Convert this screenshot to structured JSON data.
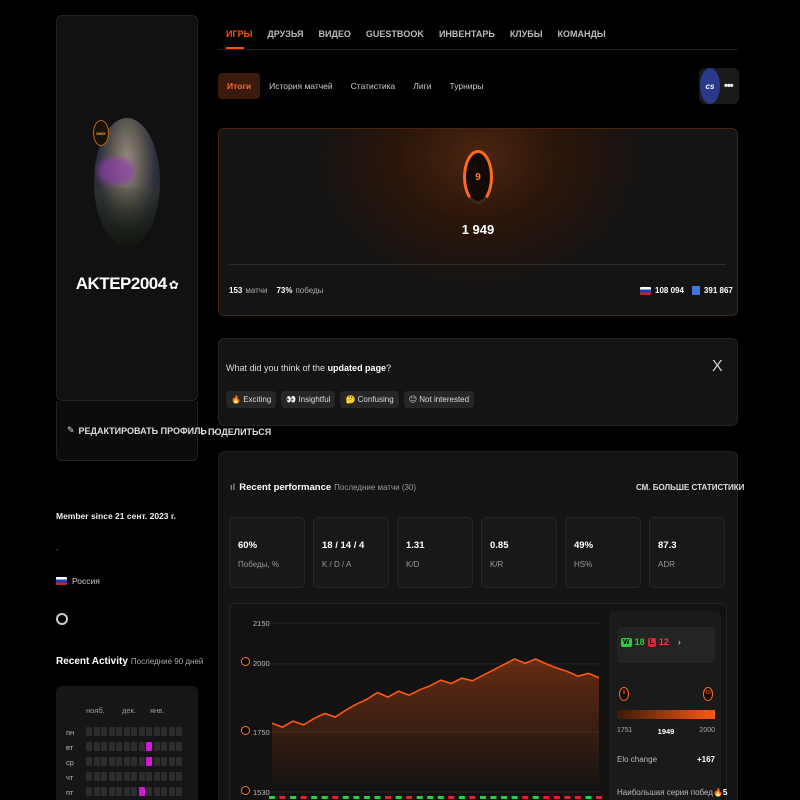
{
  "profile": {
    "username": "AKTEP2004",
    "level_badge": "MMX",
    "edit_label": "РЕДАКТИРОВАТЬ ПРОФИЛЬ",
    "share_label": "ПОДЕЛИТЬСЯ",
    "member_since": "Member since 21 сент. 2023 г.",
    "dot": ".",
    "country": "Россия"
  },
  "activity": {
    "title": "Recent Activity",
    "subtitle": "Последние 90 дней",
    "months": [
      "нояб.",
      "дек.",
      "янв."
    ],
    "days": [
      "пн",
      "вт",
      "ср",
      "чт",
      "пт"
    ]
  },
  "nav": {
    "items": [
      "ИГРЫ",
      "ДРУЗЬЯ",
      "ВИДЕО",
      "GUESTBOOK",
      "ИНВЕНТАРЬ",
      "КЛУБЫ",
      "КОМАНДЫ"
    ]
  },
  "subtabs": [
    "Итоги",
    "История матчей",
    "Статистика",
    "Лиги",
    "Турниры"
  ],
  "game_logo": "cs",
  "elo": {
    "level": "9",
    "value": "1 949",
    "matches": "153",
    "matches_label": "матчи",
    "winrate": "73%",
    "winrate_label": "победы",
    "country_rank": "108 094",
    "world_rank": "391 867"
  },
  "feedback": {
    "question_start": "What did you think of the ",
    "question_bold": "updated page",
    "question_end": "?",
    "close": "X",
    "options": [
      {
        "emoji": "🔥",
        "label": "Exciting"
      },
      {
        "emoji": "👀",
        "label": "Insightful"
      },
      {
        "emoji": "🤔",
        "label": "Confusing"
      },
      {
        "emoji": "😐",
        "label": "Not interested"
      }
    ]
  },
  "performance": {
    "title": "Recent performance",
    "subtitle": "Последние матчи (30)",
    "more": "СМ. БОЛЬШЕ СТАТИСТИКИ",
    "stats": [
      {
        "value": "60%",
        "label": "Победы, %"
      },
      {
        "value": "18 / 14 / 4",
        "label": "K / D / A"
      },
      {
        "value": "1.31",
        "label": "K/D"
      },
      {
        "value": "0.85",
        "label": "K/R"
      },
      {
        "value": "49%",
        "label": "HS%"
      },
      {
        "value": "87.3",
        "label": "ADR"
      }
    ]
  },
  "chart_data": {
    "type": "area",
    "yticks": [
      2150,
      2000,
      1750,
      1530
    ],
    "ylim": [
      1530,
      2150
    ],
    "values": [
      1782,
      1768,
      1790,
      1776,
      1800,
      1818,
      1805,
      1830,
      1852,
      1870,
      1895,
      1878,
      1900,
      1885,
      1905,
      1920,
      1940,
      1928,
      1948,
      1938,
      1958,
      1978,
      1998,
      2018,
      2002,
      2018,
      2000,
      1985,
      1972,
      1955,
      1965,
      1949
    ]
  },
  "side": {
    "wins": "18",
    "losses": "12",
    "w": "W",
    "l": "L",
    "chev": "›",
    "min": "1751",
    "current": "1949",
    "max": "2000",
    "elo_change_label": "Elo change",
    "elo_change": "+167",
    "streak_label": "Наибольшая серия побед",
    "streak": "5",
    "lvl_low": "8",
    "lvl_high": "10"
  }
}
